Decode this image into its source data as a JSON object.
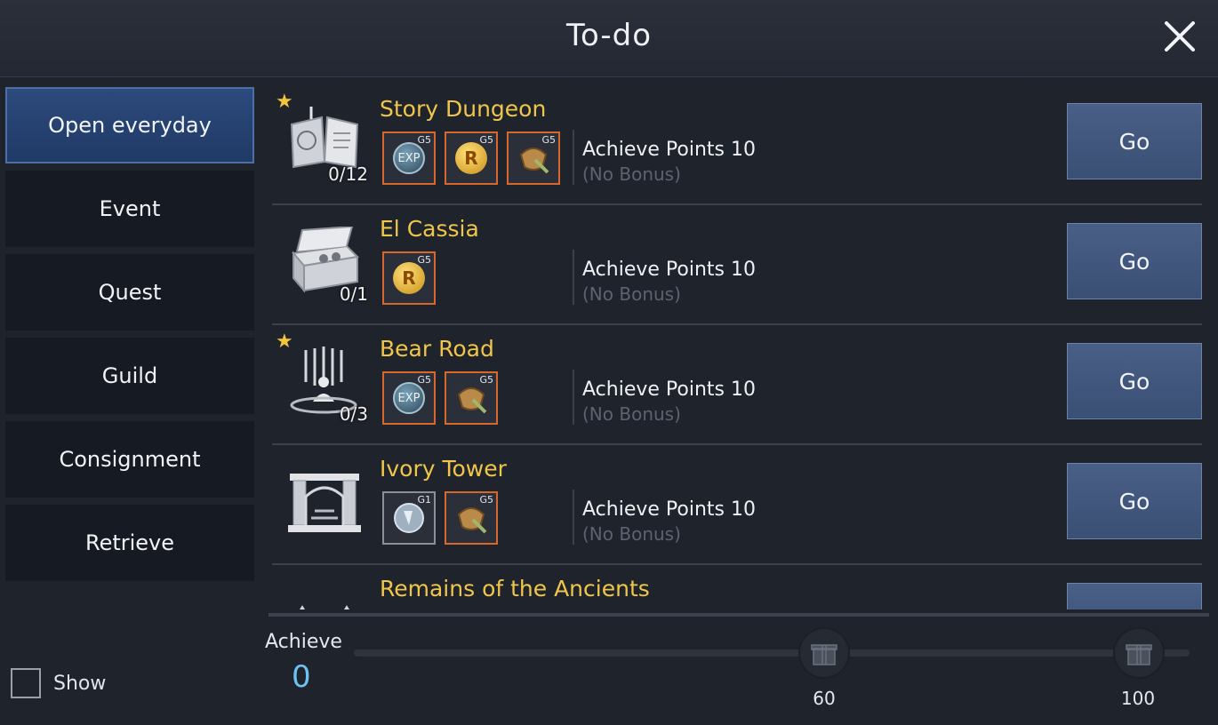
{
  "header": {
    "title": "To-do",
    "close_icon": "close-icon"
  },
  "sidebar": {
    "items": [
      {
        "label": "Open everyday",
        "active": true
      },
      {
        "label": "Event"
      },
      {
        "label": "Quest"
      },
      {
        "label": "Guild"
      },
      {
        "label": "Consignment"
      },
      {
        "label": "Retrieve"
      }
    ],
    "show_label": "Show"
  },
  "rows": [
    {
      "name": "Story Dungeon",
      "count": "0/12",
      "starred": true,
      "points": "Achieve Points 10",
      "bonus": "(No Bonus)",
      "go": "Go",
      "rewards": [
        {
          "type": "exp",
          "label": "EXP",
          "grade": "G5"
        },
        {
          "type": "coin",
          "label": "R",
          "grade": "G5"
        },
        {
          "type": "armor",
          "grade": "G5"
        }
      ]
    },
    {
      "name": "El Cassia",
      "count": "0/1",
      "starred": false,
      "points": "Achieve Points 10",
      "bonus": "(No Bonus)",
      "go": "Go",
      "rewards": [
        {
          "type": "coin",
          "label": "R",
          "grade": "G5"
        }
      ]
    },
    {
      "name": "Bear Road",
      "count": "0/3",
      "starred": true,
      "points": "Achieve Points 10",
      "bonus": "(No Bonus)",
      "go": "Go",
      "rewards": [
        {
          "type": "exp",
          "label": "EXP",
          "grade": "G5"
        },
        {
          "type": "armor",
          "grade": "G5"
        }
      ]
    },
    {
      "name": "Ivory Tower",
      "count": "",
      "starred": false,
      "points": "Achieve Points 10",
      "bonus": "(No Bonus)",
      "go": "Go",
      "rewards": [
        {
          "type": "stone",
          "grade": "G1"
        },
        {
          "type": "armor",
          "grade": "G5"
        }
      ]
    },
    {
      "name": "Remains of the Ancients"
    }
  ],
  "achieve": {
    "label": "Achieve",
    "value": "0",
    "milestones": [
      "60",
      "100"
    ]
  }
}
